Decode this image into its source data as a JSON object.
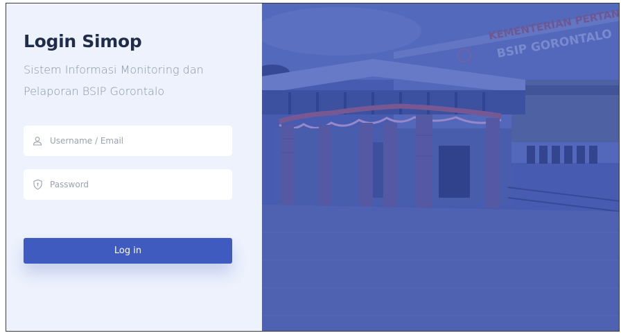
{
  "login": {
    "title": "Login Simop",
    "subtitle": "Sistem Informasi Monitoring dan Pelaporan BSIP Gorontalo",
    "username_placeholder": "Username / Email",
    "password_placeholder": "Password",
    "button_label": "Log in"
  },
  "hero": {
    "sign_line1": "KEMENTERIAN PERTANIAN",
    "sign_line2": "BSIP GORONTALO",
    "overlay_color": "#3f55b0"
  },
  "icons": {
    "username": "user-icon",
    "password": "shield-icon"
  },
  "colors": {
    "panel_bg": "#edf2fc",
    "accent": "#3f5bbf",
    "title": "#1f2d4a",
    "subtitle": "#8a93a6"
  }
}
